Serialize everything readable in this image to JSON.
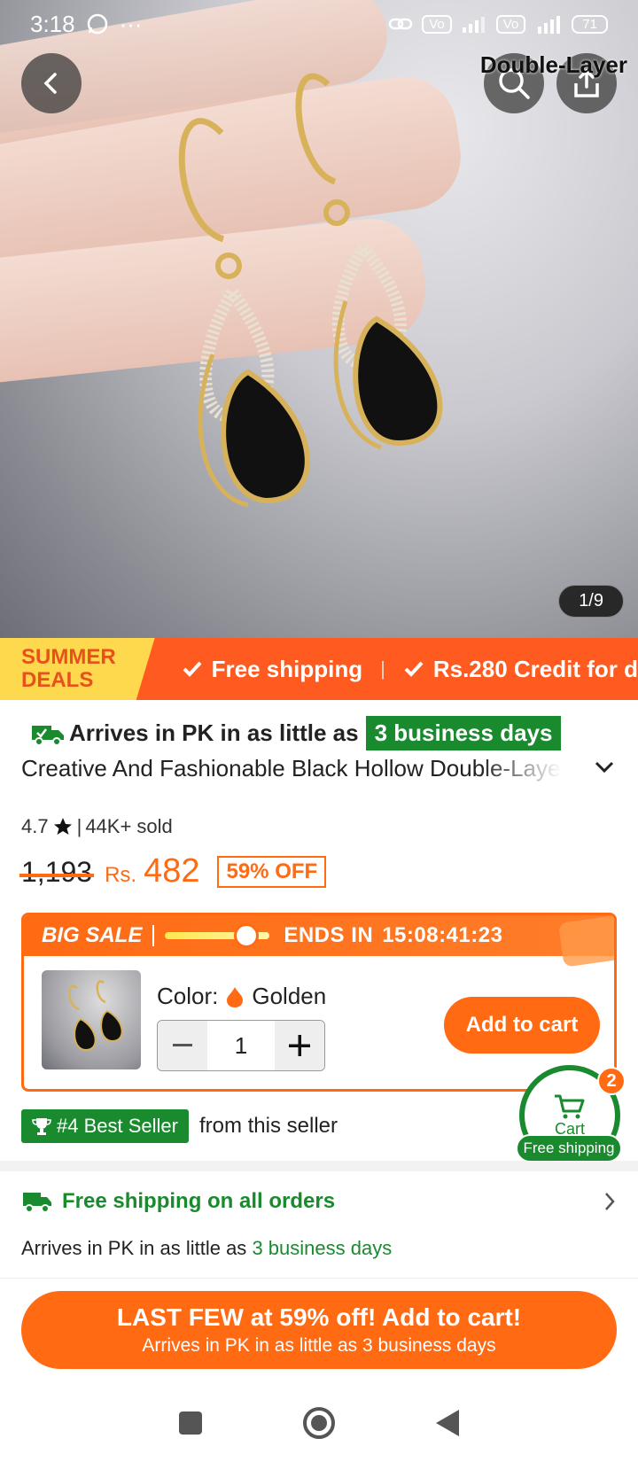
{
  "status_bar": {
    "time": "3:18",
    "indicators": [
      "whatsapp-icon",
      "more-dots-icon"
    ],
    "right": [
      "link-icon",
      "volte-icon",
      "signal-icon",
      "volte-icon",
      "4g-signal-icon"
    ],
    "battery": "71"
  },
  "hero": {
    "watermark": "Double-Layer",
    "pager": "1/9"
  },
  "deals_banner": {
    "badge_line1": "SUMMER",
    "badge_line2": "DEALS",
    "item1": "Free shipping",
    "item2": "Rs.280 Credit for d"
  },
  "delivery": {
    "prefix": "Arrives in PK in as little as",
    "highlight": "3 business days"
  },
  "product": {
    "title": "Creative And Fashionable Black Hollow Double-Layer",
    "rating": "4.7",
    "sold": "44K+ sold",
    "old_price": "1,193",
    "currency": "Rs.",
    "price": "482",
    "discount": "59% OFF"
  },
  "big_sale": {
    "title": "BIG SALE",
    "ends_label": "ENDS IN",
    "countdown": "15:08:41:23",
    "color_label": "Color:",
    "color_value": "Golden",
    "quantity": "1",
    "add_to_cart": "Add to cart"
  },
  "best_seller": {
    "badge": "#4 Best Seller",
    "text": "from this seller"
  },
  "floating_cart": {
    "label": "Cart",
    "count": "2",
    "free_shipping": "Free shipping"
  },
  "shipping": {
    "title": "Free shipping on all orders",
    "sub_prefix": "Arrives in PK in as little as",
    "sub_highlight": "3 business days"
  },
  "cta": {
    "main": "LAST FEW at 59% off! Add to cart!",
    "sub": "Arrives in PK in as little as 3 business days"
  },
  "colors": {
    "accent": "#ff6a13",
    "green": "#1a8a2e",
    "banner": "#ff5a1f",
    "badge_yellow": "#ffd94d"
  }
}
